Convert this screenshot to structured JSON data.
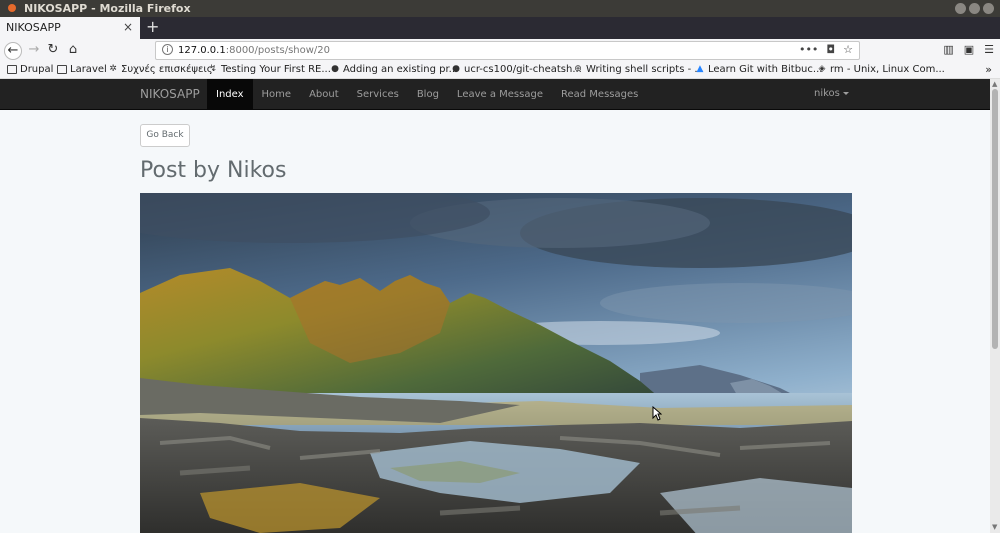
{
  "window": {
    "title": "NIKOSAPP - Mozilla Firefox"
  },
  "tab": {
    "label": "NIKOSAPP",
    "close": "×",
    "new_tab": "+"
  },
  "address": {
    "host": "127.0.0.1",
    "path": ":8000/posts/show/20",
    "more": "•••"
  },
  "bookmarks": [
    {
      "label": "Drupal",
      "icon": "folder-icon"
    },
    {
      "label": "Laravel",
      "icon": "folder-icon"
    },
    {
      "label": "Συχνές επισκέψεις",
      "icon": "gear-icon"
    },
    {
      "label": "Testing Your First RE...",
      "icon": "link-icon"
    },
    {
      "label": "Adding an existing pr...",
      "icon": "github-icon"
    },
    {
      "label": "ucr-cs100/git-cheatsh...",
      "icon": "github-icon"
    },
    {
      "label": "Writing shell scripts - ...",
      "icon": "globe-icon"
    },
    {
      "label": "Learn Git with Bitbuc...",
      "icon": "bitbucket-icon"
    },
    {
      "label": "rm - Unix, Linux Com...",
      "icon": "diamond-icon"
    }
  ],
  "app": {
    "brand": "NIKOSAPP",
    "nav": [
      {
        "label": "Index",
        "active": true
      },
      {
        "label": "Home",
        "active": false
      },
      {
        "label": "About",
        "active": false
      },
      {
        "label": "Services",
        "active": false
      },
      {
        "label": "Blog",
        "active": false
      },
      {
        "label": "Leave a Message",
        "active": false
      },
      {
        "label": "Read Messages",
        "active": false
      }
    ],
    "user": "nikos"
  },
  "page": {
    "go_back": "Go Back",
    "title": "Post by Nikos"
  }
}
